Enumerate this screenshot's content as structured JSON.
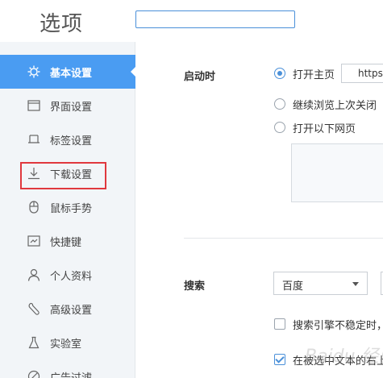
{
  "header": {
    "title": "选项",
    "search_value": ""
  },
  "sidebar": {
    "items": [
      {
        "label": "基本设置",
        "icon": "gear-icon"
      },
      {
        "label": "界面设置",
        "icon": "window-icon"
      },
      {
        "label": "标签设置",
        "icon": "tab-icon"
      },
      {
        "label": "下载设置",
        "icon": "download-icon"
      },
      {
        "label": "鼠标手势",
        "icon": "mouse-icon"
      },
      {
        "label": "快捷键",
        "icon": "keyboard-icon"
      },
      {
        "label": "个人资料",
        "icon": "user-icon"
      },
      {
        "label": "高级设置",
        "icon": "wrench-icon"
      },
      {
        "label": "实验室",
        "icon": "flask-icon"
      },
      {
        "label": "广告过滤",
        "icon": "block-icon"
      }
    ]
  },
  "startup": {
    "label": "启动时",
    "opt_home": "打开主页",
    "home_url": "https",
    "opt_continue": "继续浏览上次关闭",
    "opt_pages": "打开以下网页"
  },
  "search": {
    "label": "搜索",
    "engine": "百度",
    "opt_unstable": "搜索引擎不稳定时，",
    "opt_selected": "在被选中文本的右上"
  },
  "watermark": "Baidu 经验",
  "colors": {
    "accent": "#4a9cf2",
    "highlight_border": "#e0383e"
  }
}
